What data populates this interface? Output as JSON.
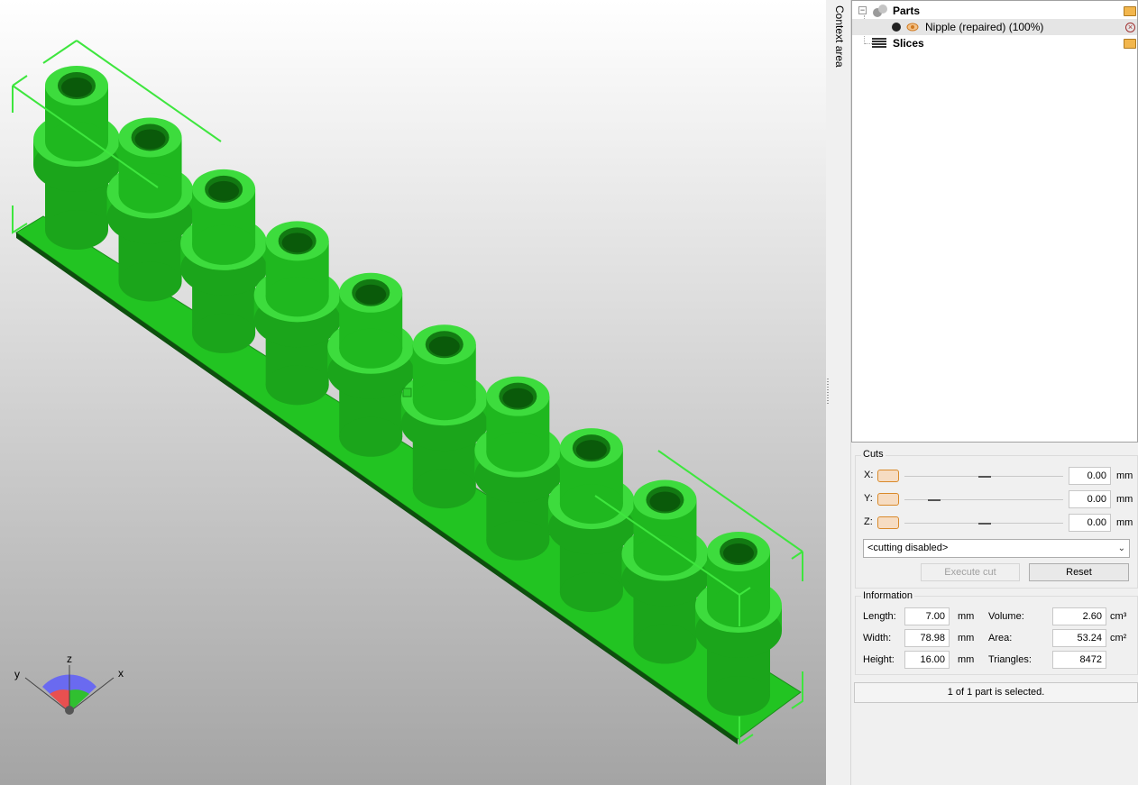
{
  "context": {
    "label": "Context area"
  },
  "tree": {
    "parts_label": "Parts",
    "part_item_label": "Nipple (repaired) (100%)",
    "slices_label": "Slices"
  },
  "cuts": {
    "title": "Cuts",
    "x_label": "X:",
    "y_label": "Y:",
    "z_label": "Z:",
    "x_value": "0.00",
    "y_value": "0.00",
    "z_value": "0.00",
    "unit": "mm",
    "mode_selected": "<cutting disabled>",
    "execute_label": "Execute cut",
    "reset_label": "Reset"
  },
  "information": {
    "title": "Information",
    "length_label": "Length:",
    "length_value": "7.00",
    "width_label": "Width:",
    "width_value": "78.98",
    "height_label": "Height:",
    "height_value": "16.00",
    "mm": "mm",
    "volume_label": "Volume:",
    "volume_value": "2.60",
    "volume_unit": "cm³",
    "area_label": "Area:",
    "area_value": "53.24",
    "area_unit": "cm²",
    "triangles_label": "Triangles:",
    "triangles_value": "8472"
  },
  "status": {
    "text": "1 of 1 part is selected."
  },
  "axes": {
    "x": "x",
    "y": "y",
    "z": "z"
  },
  "model": {
    "nipple_count": 10,
    "color": "#1fb81f"
  }
}
